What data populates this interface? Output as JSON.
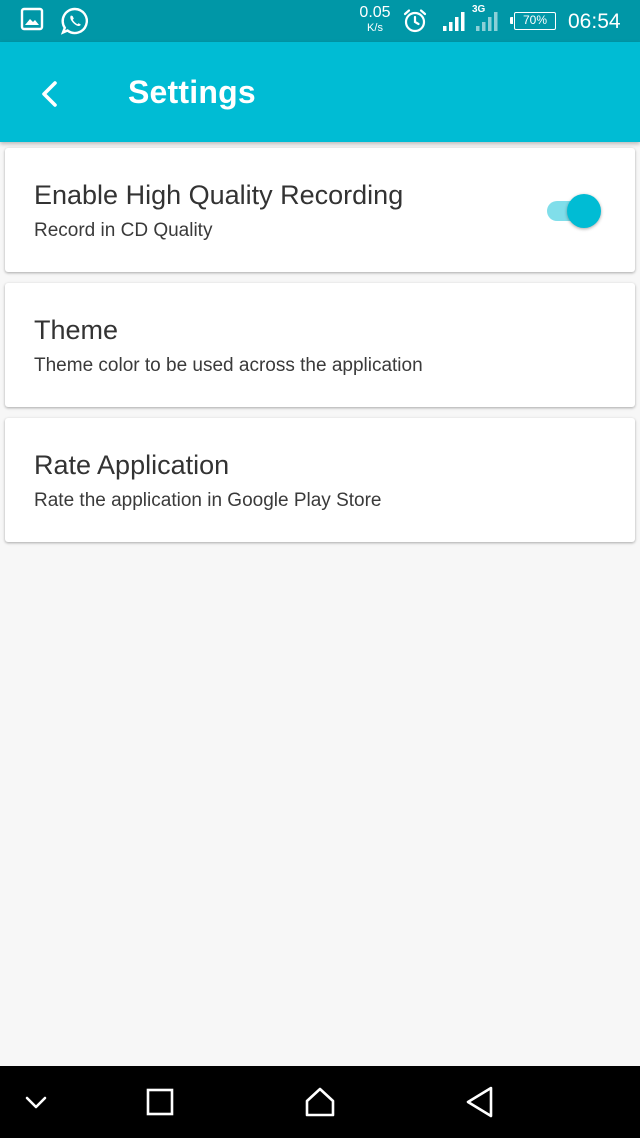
{
  "status_bar": {
    "bg_color": "#0097a7",
    "left_icons": [
      "gallery-icon",
      "whatsapp-icon"
    ],
    "net_speed": "0.05",
    "net_speed_unit": "K/s",
    "right_icons": [
      "alarm-icon",
      "signal-icon",
      "signal-3g-icon"
    ],
    "network_type": "3G",
    "battery": "70%",
    "time": "06:54"
  },
  "app_bar": {
    "bg_color": "#00bcd4",
    "back_icon": "arrow-back-icon",
    "title": "Settings"
  },
  "settings": [
    {
      "title": "Enable High Quality Recording",
      "subtitle": "Record in CD Quality",
      "toggle": true
    },
    {
      "title": "Theme",
      "subtitle": "Theme color to be used across the application"
    },
    {
      "title": "Rate Application",
      "subtitle": "Rate the application in Google Play Store"
    }
  ],
  "nav_bar": {
    "buttons": [
      "chevron-down-icon",
      "recents-icon",
      "home-icon",
      "back-triangle-icon"
    ]
  }
}
